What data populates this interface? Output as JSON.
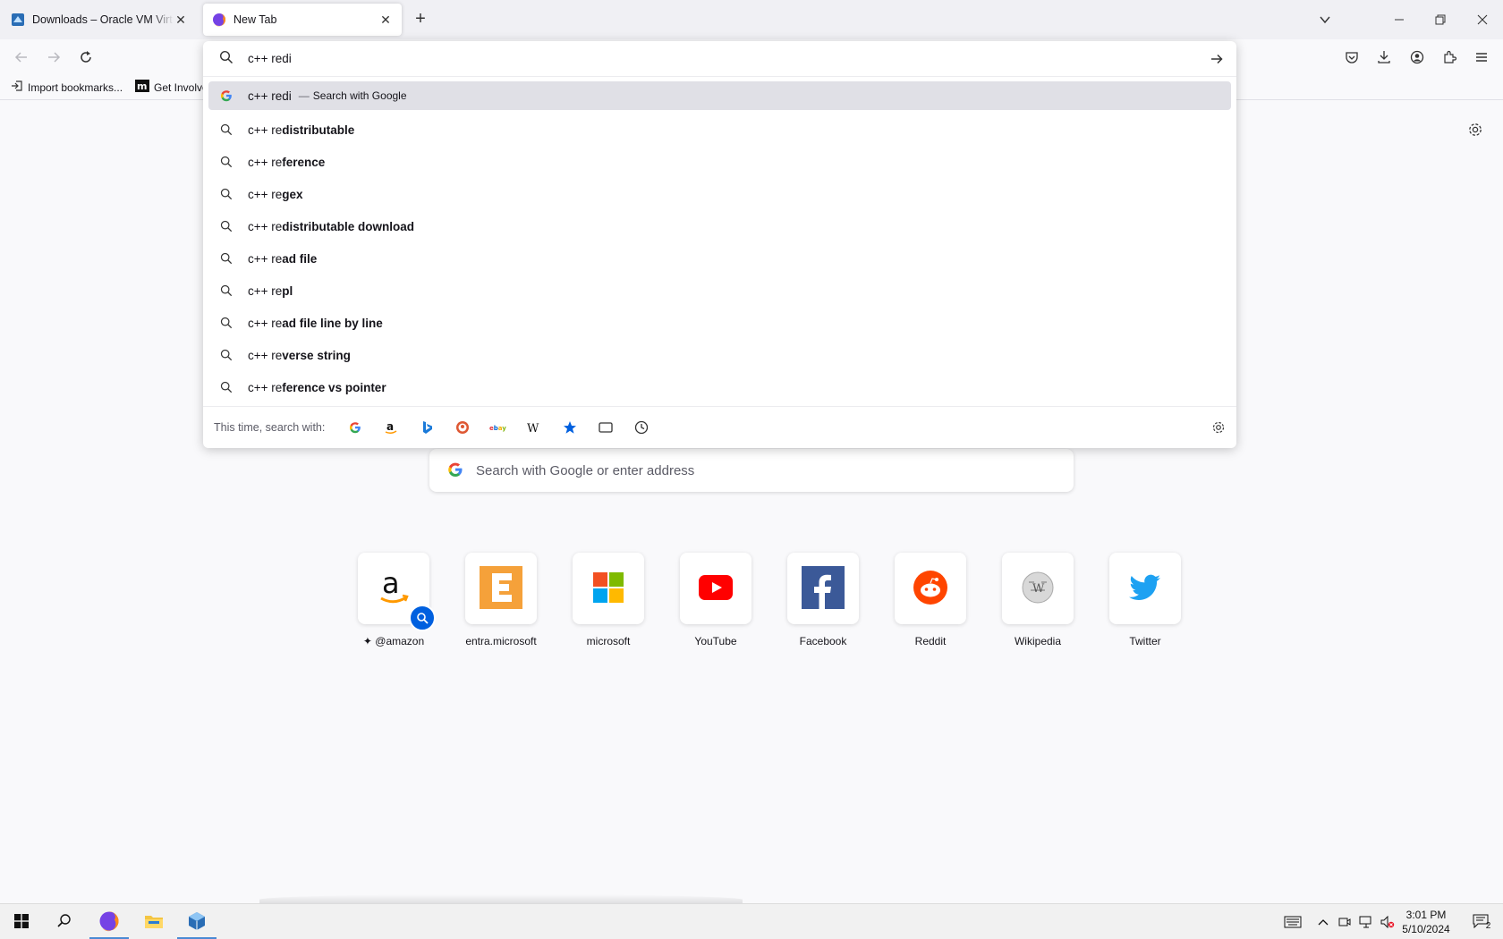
{
  "tabs": [
    {
      "title": "Downloads – Oracle VM VirtualBox",
      "close": "✕",
      "icon": "virtualbox-icon"
    },
    {
      "title": "New Tab",
      "close": "✕",
      "icon": "firefox-icon"
    }
  ],
  "new_tab_symbol": "+",
  "bookmarks": [
    {
      "label": "Import bookmarks...",
      "icon": "import-icon"
    },
    {
      "label": "Get Involved",
      "icon": "mdn-icon"
    }
  ],
  "urlbar": {
    "value": "c++ redi",
    "suggestions": [
      {
        "typed": "c++ redi",
        "dash": "—",
        "action": "Search with Google",
        "icon": "google-icon"
      },
      {
        "typed": "c++ re",
        "completion": "distributable"
      },
      {
        "typed": "c++ re",
        "completion": "ference"
      },
      {
        "typed": "c++ re",
        "completion": "gex"
      },
      {
        "typed": "c++ re",
        "completion": "distributable download"
      },
      {
        "typed": "c++ re",
        "completion": "ad file"
      },
      {
        "typed": "c++ re",
        "completion": "pl"
      },
      {
        "typed": "c++ re",
        "completion": "ad file line by line"
      },
      {
        "typed": "c++ re",
        "completion": "verse string"
      },
      {
        "typed": "c++ re",
        "completion": "ference vs pointer"
      }
    ],
    "search_with_label": "This time, search with:",
    "engines": [
      "google-icon",
      "amazon-icon",
      "bing-icon",
      "duckduckgo-icon",
      "ebay-icon",
      "wikipedia-icon",
      "bookmarks-icon",
      "tabs-icon",
      "history-icon"
    ]
  },
  "page_search": {
    "placeholder": "Search with Google or enter address"
  },
  "top_sites": [
    {
      "label": "@amazon",
      "icon": "amazon-icon"
    },
    {
      "label": "entra.microsoft",
      "icon": "entra-icon"
    },
    {
      "label": "microsoft",
      "icon": "microsoft-icon"
    },
    {
      "label": "YouTube",
      "icon": "youtube-icon"
    },
    {
      "label": "Facebook",
      "icon": "facebook-icon"
    },
    {
      "label": "Reddit",
      "icon": "reddit-icon"
    },
    {
      "label": "Wikipedia",
      "icon": "wikipedia-icon"
    },
    {
      "label": "Twitter",
      "icon": "twitter-icon"
    }
  ],
  "taskbar": {
    "time": "3:01 PM",
    "date": "5/10/2024",
    "notification_count": "2"
  }
}
